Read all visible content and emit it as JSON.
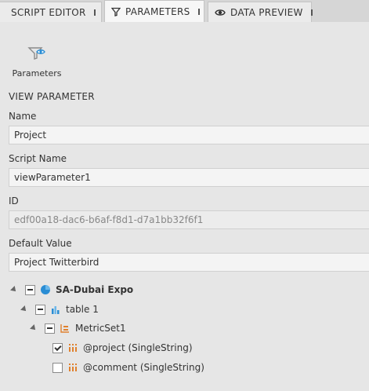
{
  "tabs": [
    {
      "label": "SCRIPT EDITOR",
      "icon": "script-icon"
    },
    {
      "label": "PARAMETERS",
      "icon": "funnel-icon"
    },
    {
      "label": "DATA PREVIEW",
      "icon": "eye-icon"
    }
  ],
  "toolbar": {
    "parameters_label": "Parameters"
  },
  "section": {
    "title": "VIEW PARAMETER"
  },
  "fields": {
    "name": {
      "label": "Name",
      "value": "Project"
    },
    "script_name": {
      "label": "Script Name",
      "value": "viewParameter1"
    },
    "id": {
      "label": "ID",
      "value": "edf00a18-dac6-b6af-f8d1-d7a1bb32f6f1"
    },
    "default_value": {
      "label": "Default Value",
      "value": "Project Twitterbird"
    }
  },
  "tree": {
    "root": {
      "label": "SA-Dubai Expo",
      "state": "partial"
    },
    "table": {
      "label": "table 1",
      "state": "partial"
    },
    "metricset": {
      "label": "MetricSet1",
      "state": "partial"
    },
    "items": [
      {
        "label": "@project (SingleString)",
        "checked": true
      },
      {
        "label": "@comment (SingleString)",
        "checked": false
      }
    ]
  },
  "colors": {
    "accent": "#2a8dd4",
    "metric_orange": "#e0812e"
  }
}
